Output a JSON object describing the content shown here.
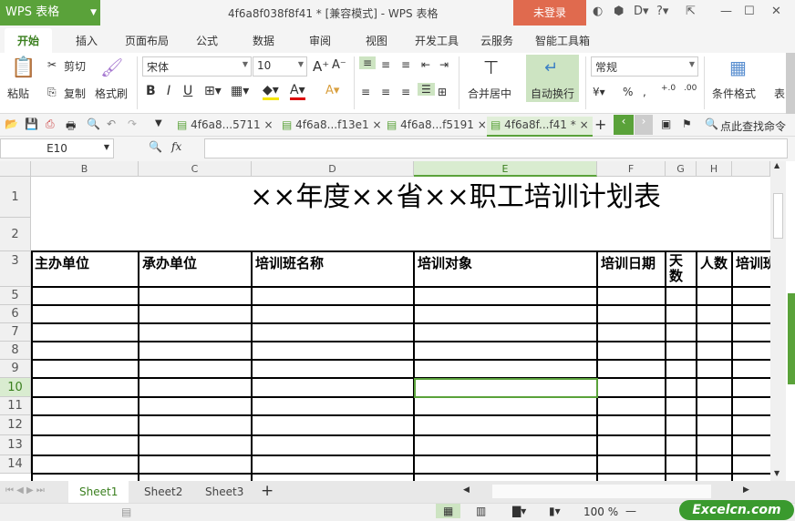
{
  "app": {
    "logo": "WPS 表格",
    "title": "4f6a8f038f8f41 * [兼容模式] - WPS 表格",
    "login": "未登录"
  },
  "menu_tabs": [
    "开始",
    "插入",
    "页面布局",
    "公式",
    "数据",
    "审阅",
    "视图",
    "开发工具",
    "云服务",
    "智能工具箱"
  ],
  "ribbon": {
    "paste": "粘贴",
    "cut": "剪切",
    "copy": "复制",
    "format_painter": "格式刷",
    "font": "宋体",
    "size": "10",
    "bold": "B",
    "italic": "I",
    "underline": "U",
    "merge": "合并居中",
    "wrap": "自动换行",
    "number_format": "常规",
    "percent": "%",
    "comma": ",",
    "cond_format": "条件格式",
    "more": "表"
  },
  "doc_tabs": [
    "4f6a8...5711",
    "4f6a8...f13e1",
    "4f6a8...f5191",
    "4f6a8f...f41 *"
  ],
  "search_cmd": "点此查找命令",
  "formula": {
    "name_box": "E10",
    "fx": "fx",
    "value": ""
  },
  "columns": [
    "B",
    "C",
    "D",
    "E",
    "F",
    "G",
    "H",
    ""
  ],
  "rows": [
    "1",
    "2",
    "3",
    "5",
    "6",
    "7",
    "8",
    "9",
    "10",
    "11",
    "12",
    "13",
    "14"
  ],
  "active_cell": "E10",
  "sheet_title": "××年度××省××职工培训计划表",
  "headers": [
    "主办单位",
    "承办单位",
    "培训班名称",
    "培训对象",
    "培训日期",
    "天数",
    "人数",
    "培训班"
  ],
  "sheets": [
    "Sheet1",
    "Sheet2",
    "Sheet3"
  ],
  "status": {
    "zoom": "100 %",
    "brand": "Excelcn.com"
  },
  "colors": {
    "accent": "#5aa23a",
    "login": "#e06a4e"
  }
}
